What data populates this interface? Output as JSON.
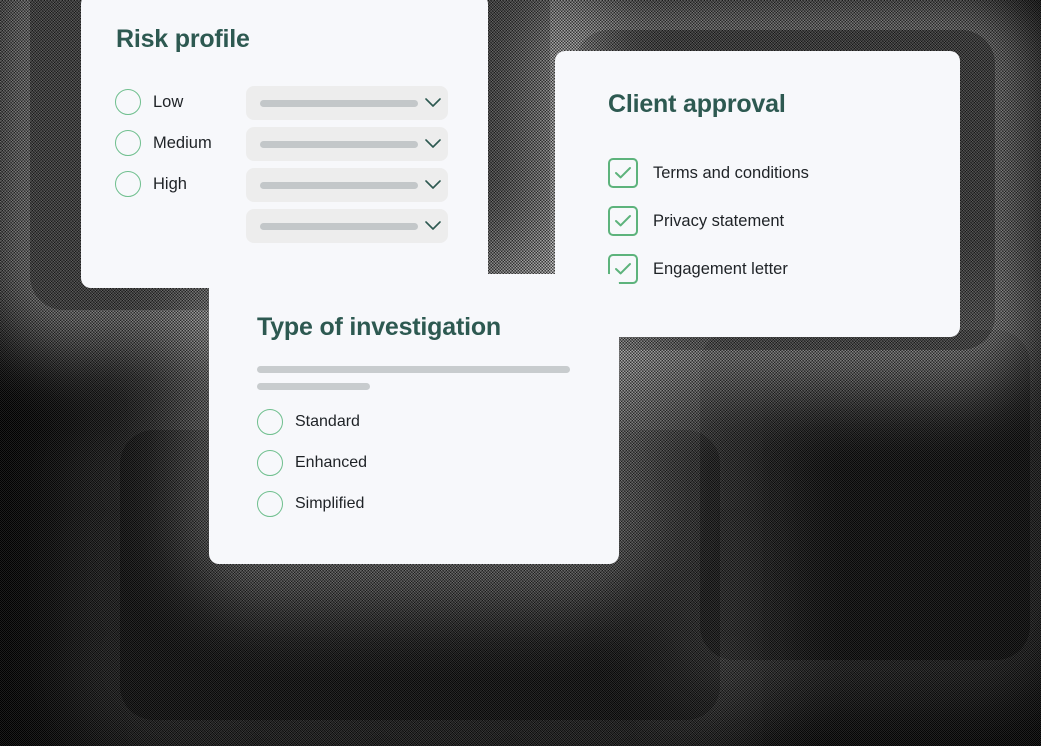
{
  "cards": {
    "risk": {
      "title": "Risk profile",
      "options": [
        {
          "label": "Low"
        },
        {
          "label": "Medium"
        },
        {
          "label": "High"
        }
      ],
      "dropdowns": [
        {
          "value": "",
          "icon": "chevron-down-icon"
        },
        {
          "value": "",
          "icon": "chevron-down-icon"
        },
        {
          "value": "",
          "icon": "chevron-down-icon"
        },
        {
          "value": "",
          "icon": "chevron-down-icon"
        }
      ]
    },
    "client": {
      "title": "Client approval",
      "items": [
        {
          "label": "Terms and conditions",
          "checked": true
        },
        {
          "label": "Privacy statement",
          "checked": true
        },
        {
          "label": "Engagement letter",
          "checked": true
        }
      ]
    },
    "type": {
      "title": "Type of investigation",
      "placeholder_lines": 2,
      "options": [
        {
          "label": "Standard"
        },
        {
          "label": "Enhanced"
        },
        {
          "label": "Simplified"
        }
      ]
    }
  },
  "colors": {
    "card_background": "#F7F8FB",
    "heading": "#2D5951",
    "radio_border": "#6FBF8E",
    "checkbox_border": "#5DB37C",
    "checkmark": "#5DB37C",
    "field_background": "#EDEDED",
    "placeholder_bar": "#C3C7C9",
    "body_text": "#1E2226",
    "page_background": "#000000"
  }
}
